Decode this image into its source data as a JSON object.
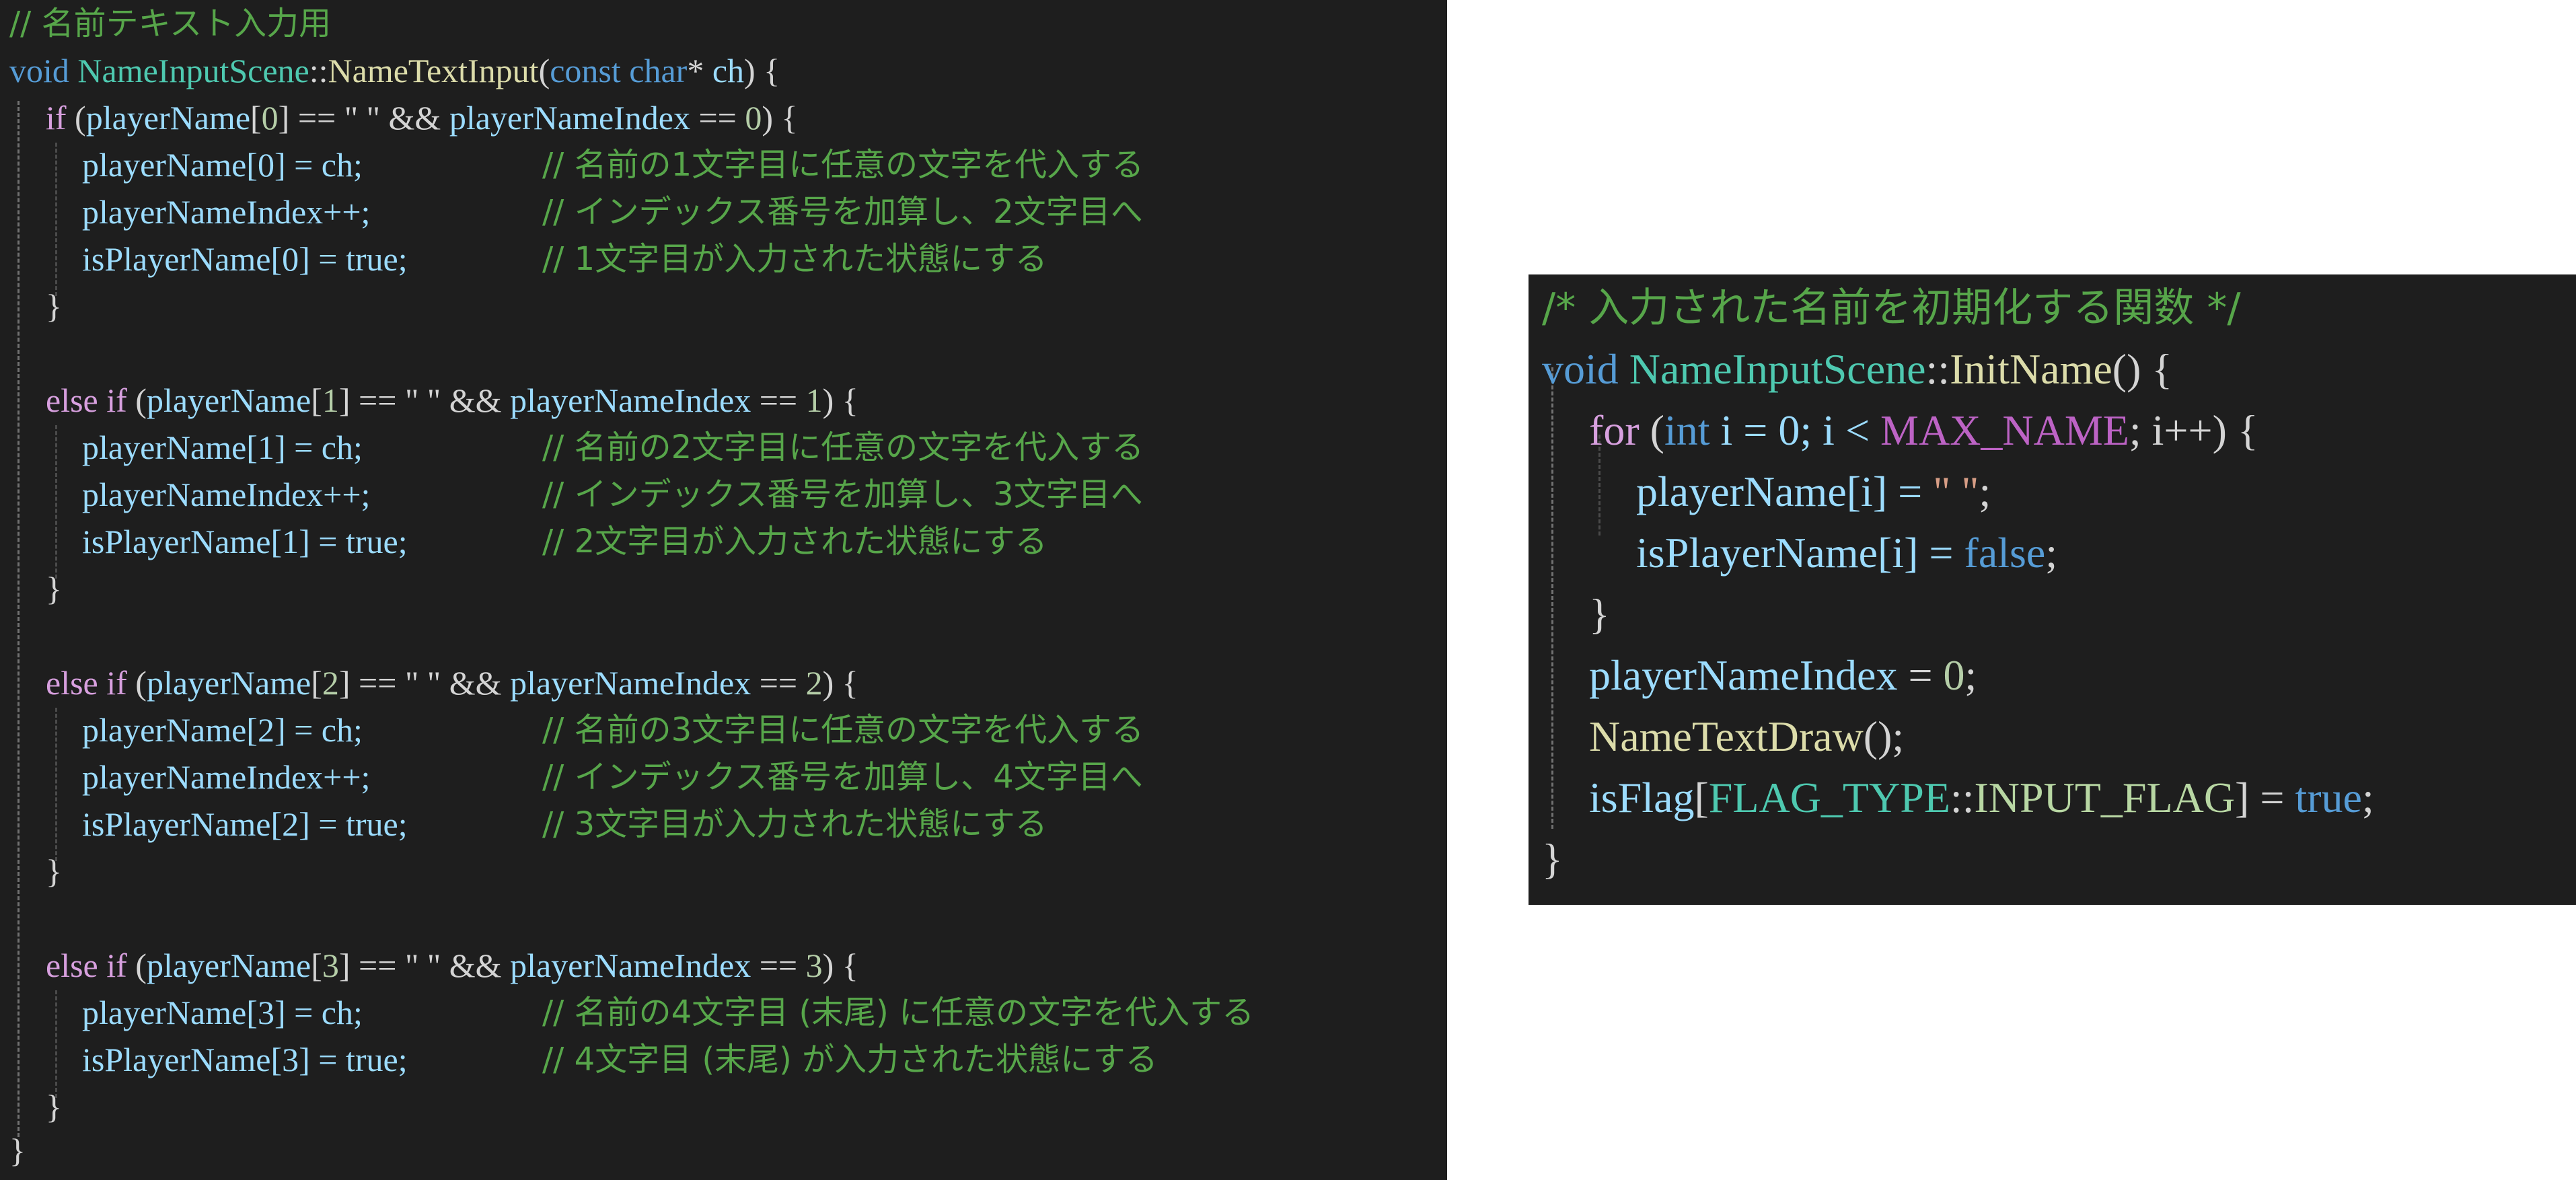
{
  "left_panel": {
    "header_comment": "// 名前テキスト入力用",
    "signature": {
      "return_type": "void",
      "class_name": "NameInputScene",
      "scope": "::",
      "function_name": "NameTextInput",
      "open_paren": "(",
      "param_qualifier": "const",
      "param_type": "char",
      "param_pointer": "*",
      "param_name": "ch",
      "close_and_brace": ") {"
    },
    "blocks": [
      {
        "keyword": "if",
        "condition_open": " (",
        "array_name": "playerName",
        "index": "0",
        "compare_tail": "] == \" \" && ",
        "index_var": "playerNameIndex",
        "compare_op": " == ",
        "compare_value": "0",
        "cond_close": ") {",
        "lines": [
          {
            "code": "playerName[0] = ch;",
            "comment": "// 名前の1文字目に任意の文字を代入する"
          },
          {
            "code": "playerNameIndex++;",
            "comment": "// インデックス番号を加算し、2文字目へ"
          },
          {
            "code": "isPlayerName[0] = true;",
            "comment": "// 1文字目が入力された状態にする"
          }
        ],
        "close": "}"
      },
      {
        "keyword": "else if",
        "condition_open": " (",
        "array_name": "playerName",
        "index": "1",
        "compare_tail": "] == \" \" && ",
        "index_var": "playerNameIndex",
        "compare_op": " == ",
        "compare_value": "1",
        "cond_close": ") {",
        "lines": [
          {
            "code": "playerName[1] = ch;",
            "comment": "// 名前の2文字目に任意の文字を代入する"
          },
          {
            "code": "playerNameIndex++;",
            "comment": "// インデックス番号を加算し、3文字目へ"
          },
          {
            "code": "isPlayerName[1] = true;",
            "comment": "// 2文字目が入力された状態にする"
          }
        ],
        "close": "}"
      },
      {
        "keyword": "else if",
        "condition_open": " (",
        "array_name": "playerName",
        "index": "2",
        "compare_tail": "] == \" \" && ",
        "index_var": "playerNameIndex",
        "compare_op": " == ",
        "compare_value": "2",
        "cond_close": ") {",
        "lines": [
          {
            "code": "playerName[2] = ch;",
            "comment": "// 名前の3文字目に任意の文字を代入する"
          },
          {
            "code": "playerNameIndex++;",
            "comment": "// インデックス番号を加算し、4文字目へ"
          },
          {
            "code": "isPlayerName[2] = true;",
            "comment": "// 3文字目が入力された状態にする"
          }
        ],
        "close": "}"
      },
      {
        "keyword": "else if",
        "condition_open": " (",
        "array_name": "playerName",
        "index": "3",
        "compare_tail": "] == \" \" && ",
        "index_var": "playerNameIndex",
        "compare_op": " == ",
        "compare_value": "3",
        "cond_close": ") {",
        "lines": [
          {
            "code": "playerName[3] = ch;",
            "comment": "// 名前の4文字目 (末尾) に任意の文字を代入する"
          },
          {
            "code": "isPlayerName[3] = true;",
            "comment": "// 4文字目 (末尾) が入力された状態にする"
          }
        ],
        "close": "}"
      }
    ],
    "function_close": "}"
  },
  "right_panel": {
    "header_comment": "/* 入力された名前を初期化する関数 */",
    "signature": {
      "return_type": "void",
      "class_name": "NameInputScene",
      "scope": "::",
      "function_name": "InitName",
      "tail": "() {"
    },
    "for_line": {
      "keyword": "for",
      "open": " (",
      "type": "int",
      "init": " i = 0; i < ",
      "macro": "MAX_NAME",
      "rest": "; i++) {"
    },
    "loop_body": [
      {
        "lhs": "playerName[i] = ",
        "rhs": "\" \"",
        "end": ";"
      },
      {
        "lhs": "isPlayerName[i] = ",
        "rhs": "false",
        "end": ";"
      }
    ],
    "loop_close": "}",
    "index_reset": {
      "var": "playerNameIndex",
      "op": " = ",
      "value": "0",
      "end": ";"
    },
    "draw_call": {
      "name": "NameTextDraw",
      "tail": "();"
    },
    "flag_line": {
      "var": "isFlag",
      "open": "[",
      "enum_type": "FLAG_TYPE",
      "scope": "::",
      "enum_value": "INPUT_FLAG",
      "close": "] = ",
      "value": "true",
      "end": ";"
    },
    "function_close": "}"
  },
  "colors": {
    "background": "#1e1e1e",
    "page": "#ffffff",
    "comment": "#57a64a",
    "keyword": "#569cd6",
    "control": "#d8a0df",
    "type": "#4ec9b0",
    "function": "#dcdcaa",
    "variable": "#9cdcfe",
    "number": "#b5cea8",
    "string": "#d69d85",
    "macro": "#bd63c5",
    "enum": "#b8d7a3",
    "text": "#d4d4d4"
  }
}
